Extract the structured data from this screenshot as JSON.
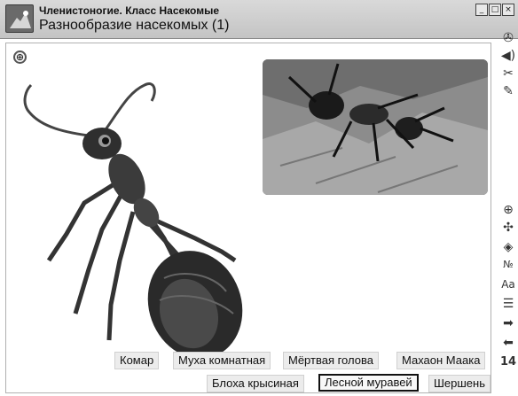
{
  "window": {
    "chapter_title": "Членистоногие. Класс Насекомые",
    "lesson_title": "Разнообразие насекомых (1)",
    "controls": [
      "_",
      "□",
      "×"
    ]
  },
  "toolbar": {
    "items": [
      {
        "icon": "gear-icon",
        "glyph": "✇"
      },
      {
        "icon": "speaker-icon",
        "glyph": "◀)"
      },
      {
        "icon": "tools-icon",
        "glyph": "✂"
      },
      {
        "icon": "pencil-icon",
        "glyph": "✎"
      },
      {
        "icon": "zoom-in-icon",
        "glyph": "⊕"
      },
      {
        "icon": "puzzle-icon",
        "glyph": "✣"
      },
      {
        "icon": "cube-icon",
        "glyph": "◈"
      },
      {
        "icon": "number-icon",
        "glyph": "№"
      },
      {
        "icon": "font-icon",
        "glyph": "Аа"
      },
      {
        "icon": "list-icon",
        "glyph": "☰"
      },
      {
        "icon": "arrow-right-icon",
        "glyph": "➡"
      },
      {
        "icon": "arrow-left-icon",
        "glyph": "⬅"
      }
    ],
    "page_number": "14"
  },
  "stage": {
    "expand_glyph": "⊕"
  },
  "species_buttons": [
    {
      "label": "Комар",
      "selected": false
    },
    {
      "label": "Муха комнатная",
      "selected": false
    },
    {
      "label": "Мёртвая голова",
      "selected": false
    },
    {
      "label": "Махаон Маака",
      "selected": false
    },
    {
      "label": "Блоха крысиная",
      "selected": false
    },
    {
      "label": "Лесной муравей",
      "selected": true
    },
    {
      "label": "Шершень",
      "selected": false
    }
  ],
  "colors": {
    "titlebar": "#cfcfcf",
    "selected_border": "#111111",
    "button_bg": "#ececec"
  }
}
